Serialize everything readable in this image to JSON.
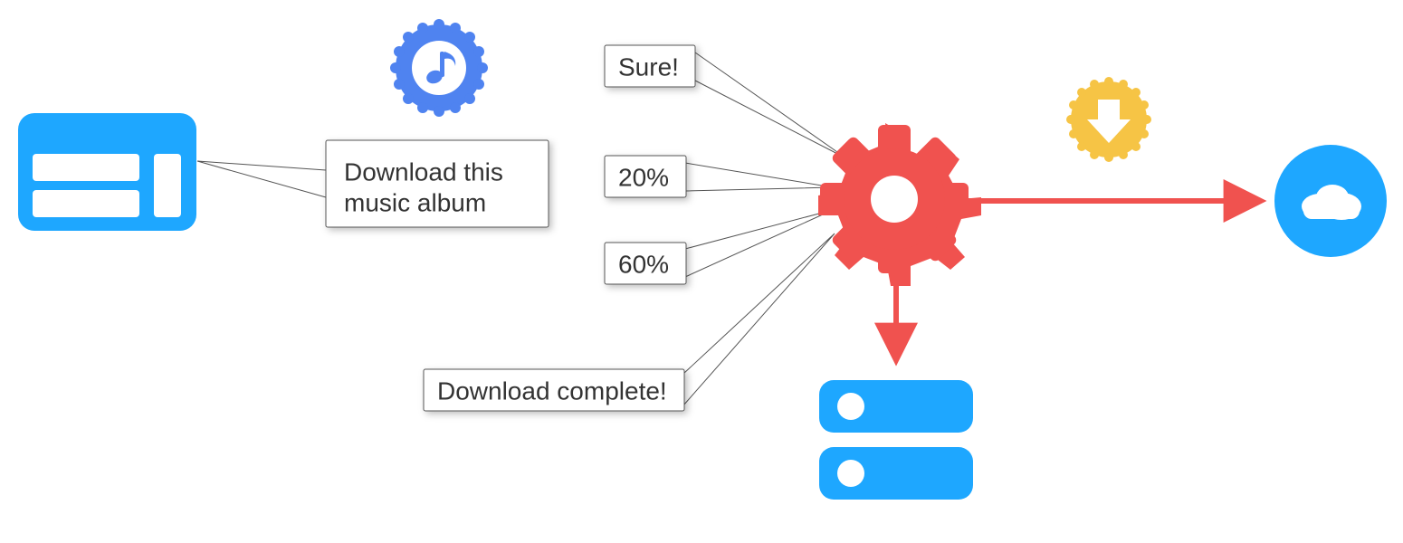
{
  "colors": {
    "blue": "#1EA7FF",
    "badge_blue": "#4F83F0",
    "red": "#F0524F",
    "yellow": "#F6C445",
    "white": "#FFFFFF",
    "stroke_gray": "#555555",
    "text": "#333333"
  },
  "callouts": {
    "request_line1": "Download this",
    "request_line2": "music album",
    "sure": "Sure!",
    "p20": "20%",
    "p60": "60%",
    "complete": "Download complete!"
  },
  "icons": {
    "music_badge": "music-note-badge-icon",
    "app_window": "app-window-icon",
    "gear": "gear-icon",
    "download_badge": "download-arrow-badge-icon",
    "cloud": "cloud-circle-icon",
    "storage": "storage-stack-icon"
  },
  "chart_data": {
    "type": "diagram",
    "description": "Flow diagram showing an application sending a download-music-album request; a processing gear reports progress (Sure, 20%, 60%, Download complete!), writes to local storage, and also reaches out to a cloud service (download arrow).",
    "nodes": [
      {
        "id": "app",
        "label": "Application window"
      },
      {
        "id": "request",
        "label": "Download this music album"
      },
      {
        "id": "gear",
        "label": "Processing gear"
      },
      {
        "id": "cloud",
        "label": "Cloud"
      },
      {
        "id": "storage",
        "label": "Storage disks"
      }
    ],
    "edges": [
      {
        "from": "app",
        "to": "request"
      },
      {
        "from": "gear",
        "to": "request",
        "messages": [
          "Sure!",
          "20%",
          "60%",
          "Download complete!"
        ]
      },
      {
        "from": "gear",
        "to": "cloud",
        "badge": "download"
      },
      {
        "from": "gear",
        "to": "storage"
      }
    ]
  }
}
